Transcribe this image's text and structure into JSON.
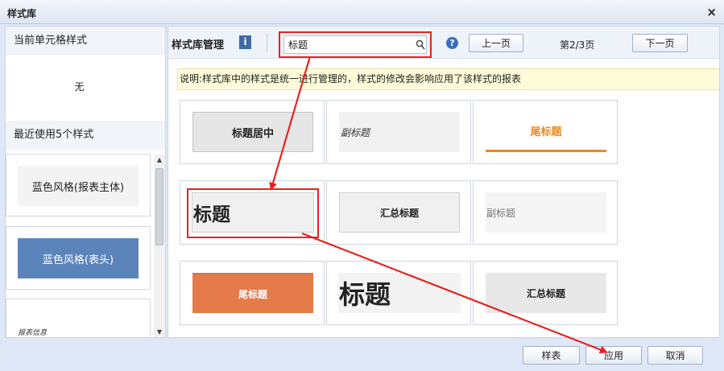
{
  "window": {
    "title": "样式库",
    "close_symbol": "×"
  },
  "left": {
    "current_header": "当前单元格样式",
    "current_value": "无",
    "recent_header": "最近使用5个样式",
    "recent": [
      {
        "label": "蓝色风格(报表主体)"
      },
      {
        "label": "蓝色风格(表头)"
      },
      {
        "label": "报表信息"
      }
    ],
    "scroll_up": "▲",
    "scroll_down": "▼"
  },
  "toolbar": {
    "title": "样式库管理",
    "info_symbol": "i",
    "search_value": "标题",
    "help_symbol": "?",
    "prev_label": "上一页",
    "page_indicator": "第2/3页",
    "next_label": "下一页"
  },
  "notice": "说明:样式库中的样式是统一进行管理的，样式的修改会影响应用了该样式的报表",
  "tiles": [
    {
      "label": "标题居中"
    },
    {
      "label": "副标题"
    },
    {
      "label": "尾标题"
    },
    {
      "label": "标题"
    },
    {
      "label": "汇总标题"
    },
    {
      "label": "副标题"
    },
    {
      "label": "尾标题"
    },
    {
      "label": "标题"
    },
    {
      "label": "汇总标题"
    }
  ],
  "footer": {
    "sample_label": "样表",
    "apply_label": "应用",
    "cancel_label": "取消"
  },
  "colors": {
    "annotation_red": "#e8231e",
    "accent_orange": "#e8891f",
    "orange_fill": "#e57a4a",
    "blue_fill": "#5b84bb"
  }
}
